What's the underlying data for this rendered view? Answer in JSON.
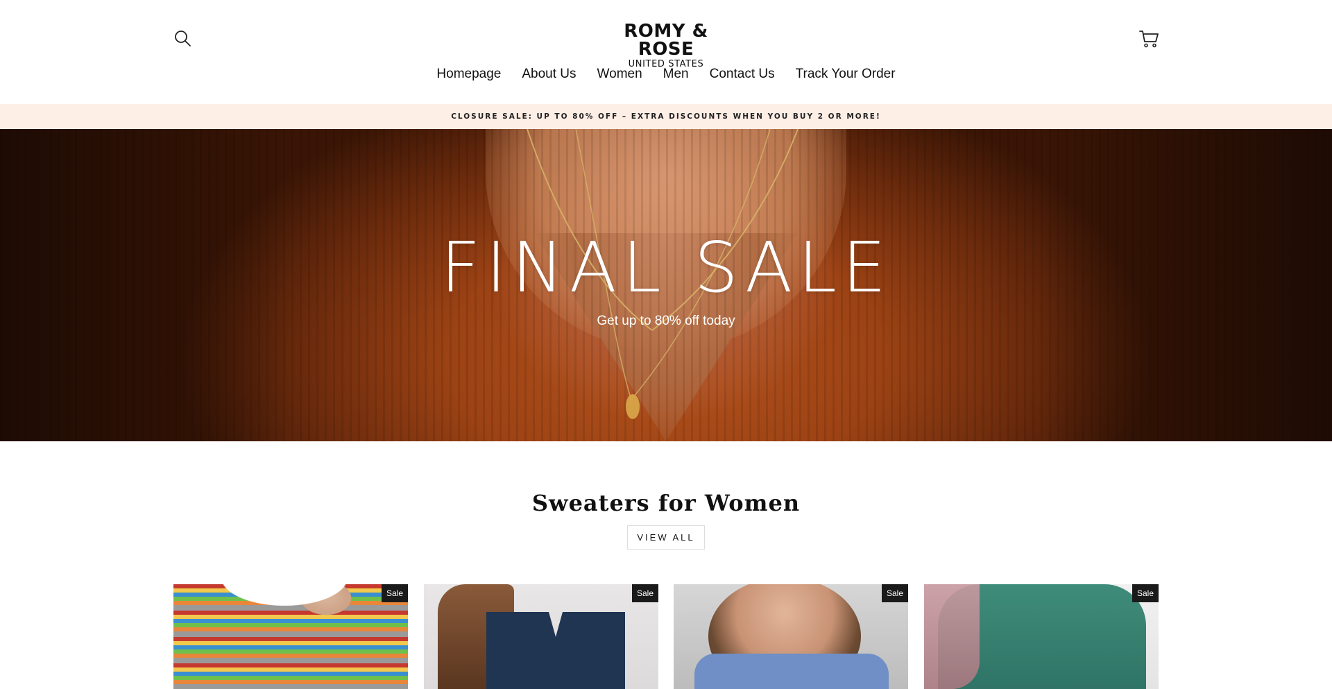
{
  "header": {
    "logo": {
      "name": "ROMY & ROSE",
      "region": "UNITED STATES"
    },
    "icons": {
      "search": "search-icon",
      "cart": "cart-icon"
    },
    "nav": [
      {
        "label": "Homepage"
      },
      {
        "label": "About Us"
      },
      {
        "label": "Women"
      },
      {
        "label": "Men"
      },
      {
        "label": "Contact Us"
      },
      {
        "label": "Track Your Order"
      }
    ]
  },
  "announcement": {
    "text": "CLOSURE SALE: UP TO 80% OFF – EXTRA DISCOUNTS WHEN YOU BUY 2 OR MORE!",
    "background": "#fdeee6"
  },
  "hero": {
    "title": "FINAL SALE",
    "subtitle": "Get up to 80% off today",
    "accent": "#a94a18"
  },
  "collection": {
    "title": "Sweaters for Women",
    "view_all_label": "VIEW ALL",
    "products": [
      {
        "badge": "Sale"
      },
      {
        "badge": "Sale"
      },
      {
        "badge": "Sale"
      },
      {
        "badge": "Sale"
      }
    ]
  }
}
